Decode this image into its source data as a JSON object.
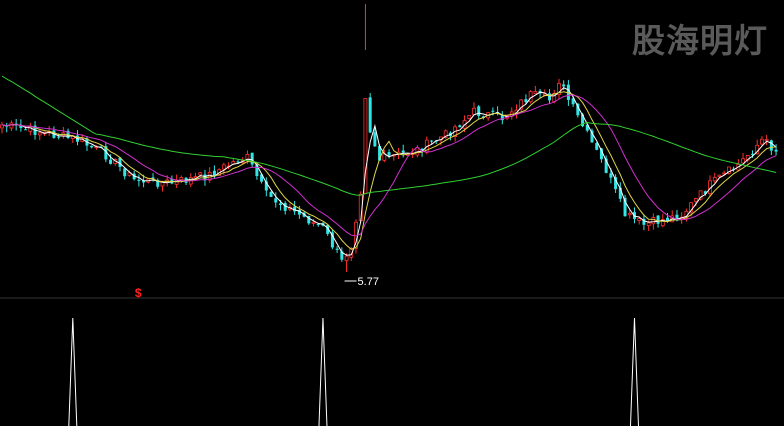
{
  "watermark": "股海明灯",
  "chart_data": {
    "type": "candlestick",
    "grid": false,
    "low_marker": {
      "label": "5.77",
      "index": 73
    },
    "signal_marker": {
      "label": "$",
      "index": 29
    },
    "colors": {
      "background": "#000000",
      "up_candle": "#ff3030",
      "down_candle": "#33e6e6",
      "ma_white": "#ffffff",
      "ma_yellow": "#e0d64a",
      "ma_magenta": "#d030d0",
      "ma_green": "#30d030",
      "indicator": "#ffffff",
      "divider": "#333333"
    },
    "indicator_spikes": [
      15,
      68,
      134
    ]
  }
}
